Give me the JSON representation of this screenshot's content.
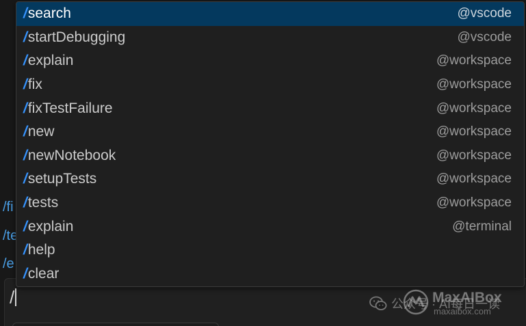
{
  "background_lines": [
    "/fi",
    "/te",
    "/e"
  ],
  "input": {
    "value": "/"
  },
  "suggestions": [
    {
      "command": "search",
      "agent": "@vscode",
      "selected": true
    },
    {
      "command": "startDebugging",
      "agent": "@vscode",
      "selected": false
    },
    {
      "command": "explain",
      "agent": "@workspace",
      "selected": false
    },
    {
      "command": "fix",
      "agent": "@workspace",
      "selected": false
    },
    {
      "command": "fixTestFailure",
      "agent": "@workspace",
      "selected": false
    },
    {
      "command": "new",
      "agent": "@workspace",
      "selected": false
    },
    {
      "command": "newNotebook",
      "agent": "@workspace",
      "selected": false
    },
    {
      "command": "setupTests",
      "agent": "@workspace",
      "selected": false
    },
    {
      "command": "tests",
      "agent": "@workspace",
      "selected": false
    },
    {
      "command": "explain",
      "agent": "@terminal",
      "selected": false
    },
    {
      "command": "help",
      "agent": "",
      "selected": false
    },
    {
      "command": "clear",
      "agent": "",
      "selected": false
    }
  ],
  "slash_glyph": "/",
  "watermark": {
    "label": "公众号 · AI每日一读",
    "brand": "MaxAIBox",
    "url": "maxaibox.com"
  },
  "colors": {
    "accent": "#3794ff",
    "selected_bg": "#04395e",
    "popup_bg": "#1f1f1f",
    "page_bg": "#181818"
  }
}
